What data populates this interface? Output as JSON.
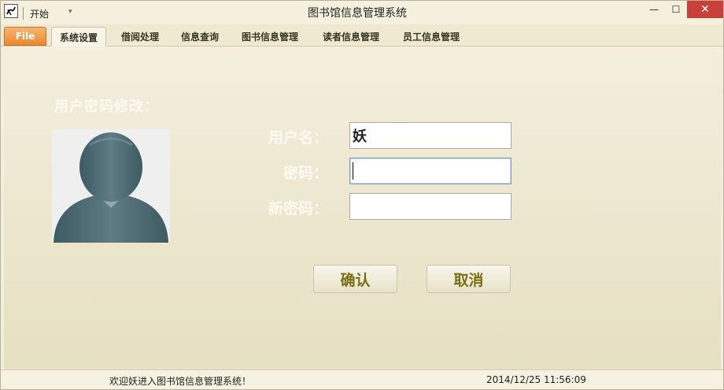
{
  "window": {
    "title": "图书馆信息管理系统",
    "quick_access_label": "开始",
    "controls": {
      "minimize": "—",
      "maximize": "☐",
      "close": "✕"
    }
  },
  "tabs": [
    {
      "label": "File",
      "active": false,
      "is_file": true
    },
    {
      "label": "系统设置",
      "active": true
    },
    {
      "label": "借阅处理",
      "active": false
    },
    {
      "label": "信息查询",
      "active": false
    },
    {
      "label": "图书信息管理",
      "active": false
    },
    {
      "label": "读者信息管理",
      "active": false
    },
    {
      "label": "员工信息管理",
      "active": false
    }
  ],
  "form": {
    "section_title": "用户密码修改：",
    "username_label": "用户名：",
    "username_value": "妖",
    "password_label": "密码：",
    "password_value": "",
    "new_password_label": "新密码：",
    "new_password_value": ""
  },
  "buttons": {
    "confirm": "确认",
    "cancel": "取消"
  },
  "status": {
    "welcome": "欢迎妖进入图书馆信息管理系统！",
    "datetime": "2014/12/25 11:56:09"
  },
  "colors": {
    "file_tab": "#e9892f",
    "close_button": "#c7413a",
    "button_text": "#7a6e13",
    "background": "#efe9d2"
  },
  "icons": {
    "app_logo": "app-logo-icon",
    "avatar": "user-avatar-icon"
  }
}
